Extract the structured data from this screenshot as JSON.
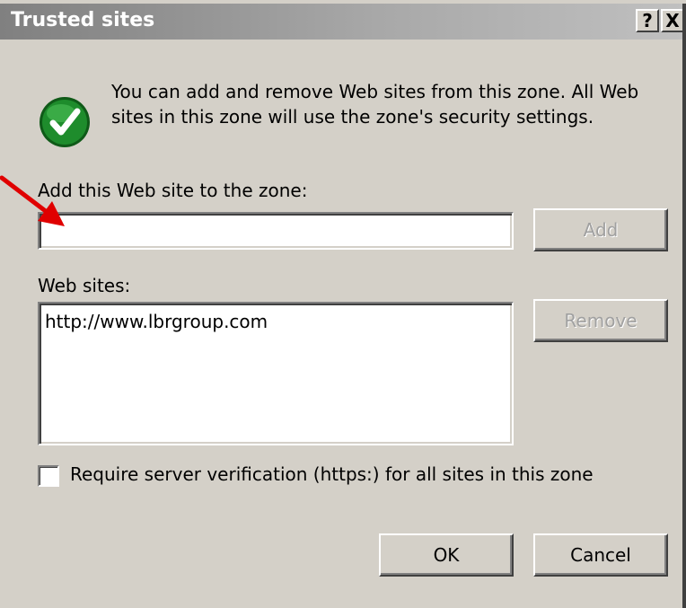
{
  "window": {
    "title": "Trusted sites",
    "help_label": "?",
    "close_label": "X"
  },
  "info": {
    "icon": "green-check-icon",
    "text": "You can add and remove Web sites from this zone. All Web sites in this zone will use the zone's security settings."
  },
  "add_section": {
    "label": "Add this Web site to the zone:",
    "input_value": "",
    "add_button": "Add",
    "add_enabled": false
  },
  "sites_section": {
    "label": "Web sites:",
    "sites": [
      "http://www.lbrgroup.com"
    ],
    "remove_button": "Remove",
    "remove_enabled": false
  },
  "verification": {
    "label": "Require server verification (https:) for all sites in this zone",
    "checked": false
  },
  "buttons": {
    "ok": "OK",
    "cancel": "Cancel"
  },
  "colors": {
    "dialog_bg": "#d4d0c8",
    "arrow": "#e00000",
    "check_green": "#1e8c2c"
  }
}
